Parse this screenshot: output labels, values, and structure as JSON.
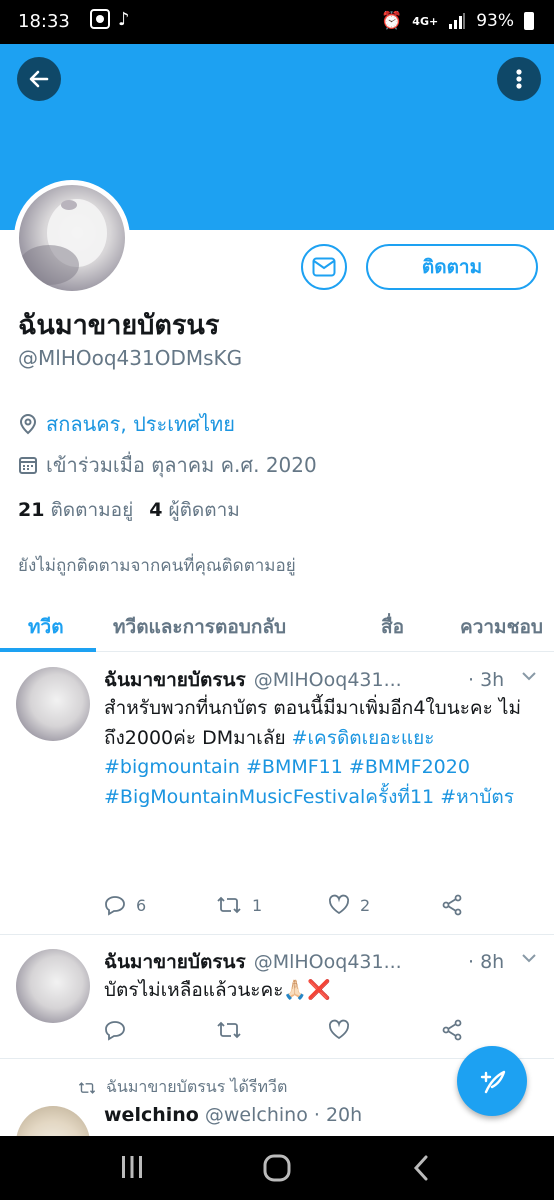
{
  "status_bar": {
    "time": "18:33",
    "network": "4G+",
    "battery": "93%"
  },
  "profile": {
    "display_name": "ฉันมาขายบัตรนร",
    "handle": "@MlHOoq431ODMsKG",
    "location": "สกลนคร, ประเทศไทย",
    "joined": "เข้าร่วมเมื่อ ตุลาคม ค.ศ. 2020",
    "following_count": "21",
    "following_label": "ติดตามอยู่",
    "followers_count": "4",
    "followers_label": "ผู้ติดตาม",
    "notice": "ยังไม่ถูกติดตามจากคนที่คุณติดตามอยู่",
    "follow_button": "ติดตาม"
  },
  "tabs": [
    {
      "label": "ทวีต",
      "active": true
    },
    {
      "label": "ทวีตและการตอบกลับ",
      "active": false
    },
    {
      "label": "สื่อ",
      "active": false
    },
    {
      "label": "ความชอบ",
      "active": false
    }
  ],
  "tweets": [
    {
      "name": "ฉันมาขายบัตรนร",
      "handle": "@MlHOoq431...",
      "time": "· 3h",
      "text_parts": [
        "สำหรับพวกที่นกบัตร ตอนนี้มีมาเพิ่มอีก4ใบนะคะ ไม่ถึง2000ค่ะ DMมาเลัย ",
        "#เครดิตเยอะแยะ",
        " ",
        "#bigmountain",
        " ",
        "#BMMF11",
        " ",
        "#BMMF2020",
        " ",
        "#BigMountainMusicFestivalครั้งที่11",
        " ",
        "#หาบัตร"
      ],
      "replies": "6",
      "retweets": "1",
      "likes": "2"
    },
    {
      "name": "ฉันมาขายบัตรนร",
      "handle": "@MlHOoq431...",
      "time": "· 8h",
      "text": "บัตรไม่เหลือแล้วนะคะ🙏🏻❌"
    }
  ],
  "retweet": {
    "label": "ฉันมาขายบัตรนร ได้รีทวีต",
    "name": "welchino",
    "handle": "@welchino",
    "time": "· 20h"
  },
  "colors": {
    "accent": "#1da1f2",
    "link": "#1b95e0",
    "muted": "#657786",
    "text": "#14171a"
  },
  "icons": [
    "back-arrow-icon",
    "more-vertical-icon",
    "mail-icon",
    "location-pin-icon",
    "calendar-icon",
    "reply-icon",
    "retweet-icon",
    "like-icon",
    "share-icon",
    "chevron-down-icon",
    "compose-tweet-icon"
  ]
}
